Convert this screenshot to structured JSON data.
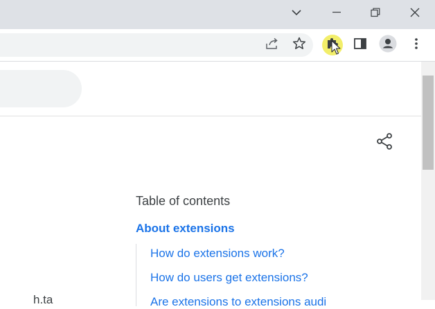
{
  "window_controls": {
    "tab_search_icon": "chevron-down-icon",
    "minimize_icon": "minimize-icon",
    "restore_icon": "restore-icon",
    "close_icon": "close-icon"
  },
  "toolbar": {
    "icons": [
      "share-icon",
      "star-icon",
      "puzzle-icon",
      "side-panel-icon",
      "profile-icon",
      "more-vert-icon"
    ],
    "extension_highlight_color": "#f2ee6a"
  },
  "page": {
    "toc": {
      "heading": "Table of contents",
      "section": "About extensions",
      "links": [
        "How do extensions work?",
        "How do users get extensions?",
        "Are extensions to extensions audi"
      ]
    },
    "fragment_text": "h.ta"
  },
  "colors": {
    "link": "#1a73e8",
    "titlebar": "#dee1e6",
    "omnibox": "#f1f3f4"
  }
}
